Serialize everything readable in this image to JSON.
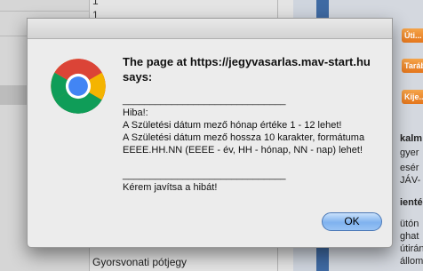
{
  "background": {
    "top_number": "1",
    "second_number": "1",
    "side_buttons": [
      "Úti...",
      "Tarábl...",
      "Kije..."
    ],
    "side_texts": [
      "kalm",
      "gyer",
      "esér",
      "JÁV-",
      "ienté",
      "ütón",
      "ghat",
      "útirány",
      "állomá"
    ],
    "bottom_left_text": "Gyorsvonati pótjegy"
  },
  "dialog": {
    "icon": "chrome-logo-icon",
    "title": "The page at https://jegyvasarlas.mav-start.hu says:",
    "message": "______________________________\nHiba!:\nA Születési dátum mező hónap értéke 1 - 12 lehet!\nA Születési dátum mező hossza 10 karakter, formátuma EEEE.HH.NN (EEEE - év, HH - hónap, NN - nap) lehet!\n\n______________________________\nKérem javítsa a hibát!",
    "ok_label": "OK"
  },
  "colors": {
    "dialog_bg": "#ececec",
    "ok_button": "#7fb2ef",
    "side_panel_blue": "#3f6aa3",
    "side_button_orange": "#e5761c"
  }
}
